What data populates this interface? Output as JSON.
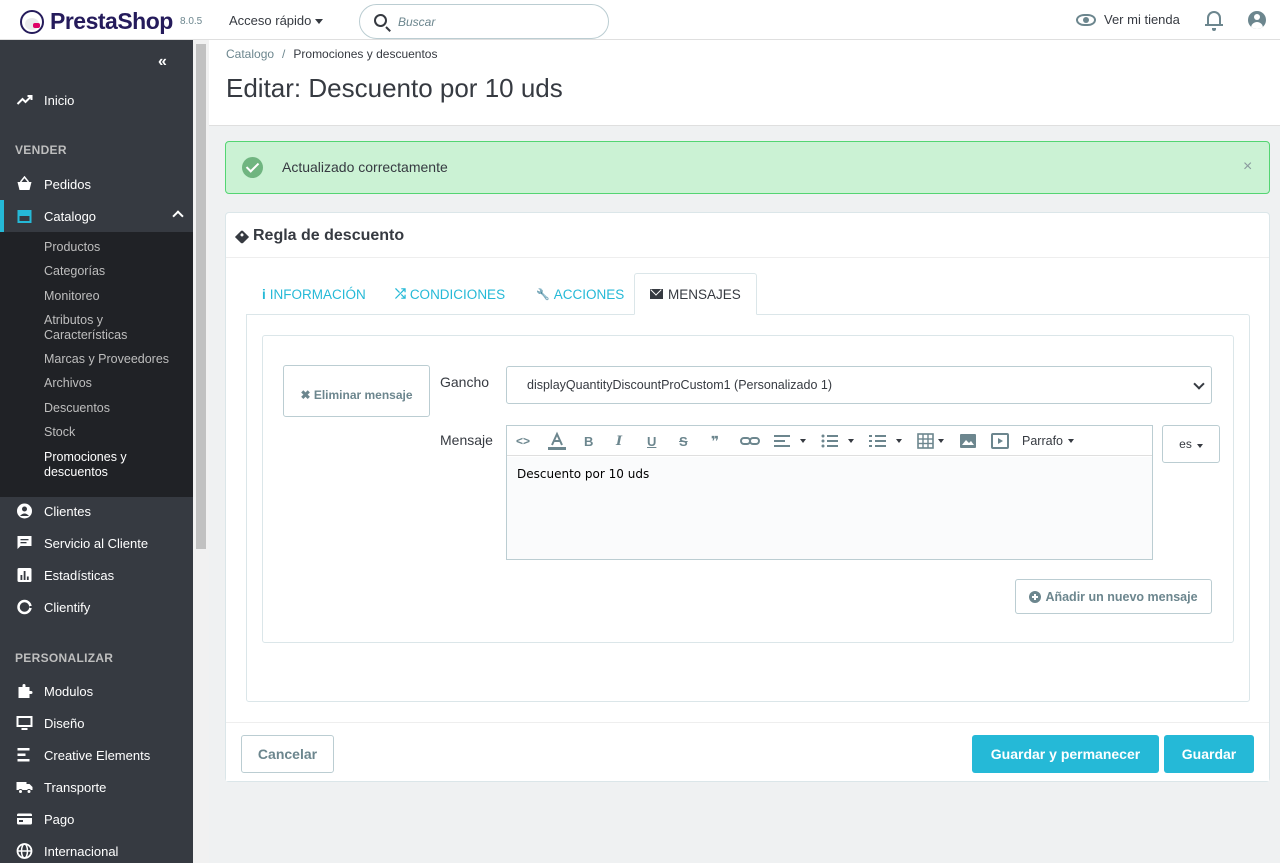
{
  "header": {
    "logo_text": "PrestaShop",
    "version": "8.0.5",
    "quick_access": "Acceso rápido",
    "search_placeholder": "Buscar",
    "view_shop": "Ver mi tienda"
  },
  "sidebar": {
    "collapse": "«",
    "home": "Inicio",
    "section_sell": "VENDER",
    "orders": "Pedidos",
    "catalog": "Catalogo",
    "catalog_sub": [
      "Productos",
      "Categorías",
      "Monitoreo",
      "Atributos y Características",
      "Marcas y Proveedores",
      "Archivos",
      "Descuentos",
      "Stock",
      "Promociones y descuentos"
    ],
    "customers": "Clientes",
    "customer_service": "Servicio al Cliente",
    "stats": "Estadísticas",
    "clientify": "Clientify",
    "section_customize": "PERSONALIZAR",
    "modules": "Modulos",
    "design": "Diseño",
    "creative_elements": "Creative Elements",
    "shipping": "Transporte",
    "payment": "Pago",
    "international": "Internacional"
  },
  "breadcrumb": {
    "first": "Catalogo",
    "separator": "/",
    "current": "Promociones y descuentos"
  },
  "page_title": "Editar: Descuento por 10 uds",
  "alert": {
    "text": "Actualizado correctamente",
    "close": "×"
  },
  "panel": {
    "title": "Regla de descuento",
    "tabs": [
      {
        "icon": "i",
        "label": "INFORMACIÓN"
      },
      {
        "icon": "⤮",
        "label": "CONDICIONES"
      },
      {
        "icon": "🔧",
        "label": "ACCIONES"
      },
      {
        "icon": "",
        "label": "MENSAJES"
      }
    ],
    "delete_message": "✖ Eliminar mensaje",
    "hook_label": "Gancho",
    "hook_value": "displayQuantityDiscountProCustom1 (Personalizado 1)",
    "message_label": "Mensaje",
    "paragraph_select": "Parrafo",
    "message_text": "Descuento por 10 uds",
    "lang": "es",
    "add_message": "Añadir un nuevo mensaje",
    "toolbar": {
      "code": "<>",
      "bold": "B",
      "italic": "I",
      "underline": "U",
      "strike": "S",
      "quote": "❞"
    }
  },
  "footer": {
    "cancel": "Cancelar",
    "save_stay": "Guardar y permanecer",
    "save": "Guardar"
  }
}
